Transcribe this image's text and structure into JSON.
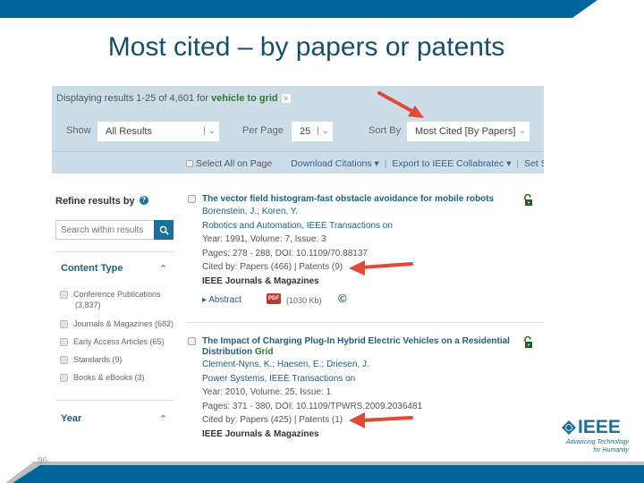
{
  "slide": {
    "title": "Most cited – by papers or patents",
    "page_number": "96",
    "brand_color": "#006699"
  },
  "search_header": {
    "displaying_prefix": "Displaying results 1-25 of 4,601 for ",
    "query": "vehicle to grid",
    "clear_icon": "×",
    "show_label": "Show",
    "show_value": "All Results",
    "per_page_label": "Per Page",
    "per_page_value": "25",
    "sort_label": "Sort By",
    "sort_value": "Most Cited [By Papers]",
    "select_all": "Select All on Page",
    "download_citations": "Download Citations ▾",
    "export": "Export to IEEE Collabratec ▾",
    "set_search": "Set Sea"
  },
  "sidebar": {
    "title": "Refine results by",
    "help_icon": "?",
    "search_placeholder": "Search within results",
    "search_icon": "⌕",
    "content_type_label": "Content Type",
    "content_types": [
      {
        "label": "Conference Publications",
        "count": "(3,837)"
      },
      {
        "label": "Journals & Magazines (682)"
      },
      {
        "label": "Early Access Articles (65)"
      },
      {
        "label": "Standards (9)"
      },
      {
        "label": "Books & eBooks (3)"
      }
    ],
    "year_label": "Year",
    "chevron": "^"
  },
  "results": [
    {
      "title": "The vector field histogram-fast obstacle avoidance for mobile robots",
      "authors": "Borenstein, J.; Koren, Y.",
      "publication": "Robotics and Automation, IEEE Transactions on",
      "year_line": "Year: 1991, Volume: 7, Issue: 3",
      "pages_line": "Pages: 278 - 288, DOI: 10.1109/70.88137",
      "cited_line": "Cited by: Papers (466) | Patents (9)",
      "source": "IEEE Journals & Magazines",
      "abstract": "▸ Abstract",
      "pdf_label": "PDF",
      "pdf_size": "(1030 Kb)",
      "copyright": "©"
    },
    {
      "title_a": "The Impact of Charging Plug-In Hybrid Electric Vehicles on a Residential",
      "title_b": "Distribution ",
      "title_highlight": "Grid",
      "authors": "Clement-Nyns, K.; Haesen, E.; Driesen, J.",
      "publication": "Power Systems, IEEE Transactions on",
      "year_line": "Year: 2010, Volume: 25, Issue: 1",
      "pages_line": "Pages: 371 - 380, DOI: 10.1109/TPWRS.2009.2036481",
      "cited_line": "Cited by: Papers (425) | Patents (1)",
      "source": "IEEE Journals & Magazines"
    }
  ],
  "logo": {
    "word": "IEEE",
    "tagline_1": "Advancing Technology",
    "tagline_2": "for Humanity"
  }
}
